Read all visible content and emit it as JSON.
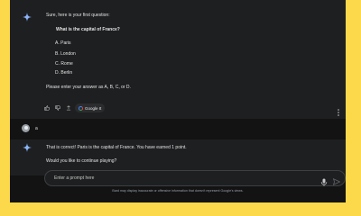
{
  "response_1": {
    "intro": "Sure, here is your first question:",
    "question": "What is the capital of France?",
    "options": [
      "A. Paris",
      "B. London",
      "C. Rome",
      "D. Berlin"
    ],
    "instruction": "Please enter your answer as A, B, C, or D."
  },
  "actions": {
    "icons": [
      "thumb-up-icon",
      "thumb-down-icon",
      "share-icon",
      "google-icon",
      "more-vert-icon"
    ],
    "google_label": "Google It"
  },
  "user_message": {
    "text": "a"
  },
  "response_2": {
    "line1": "That is correct! Paris is the capital of France. You have earned 1 point.",
    "line2": "Would you like to continue playing?"
  },
  "input": {
    "placeholder": "Enter a prompt here"
  },
  "footer": {
    "disclaimer": "Bard may display inaccurate or offensive information that doesn't represent Google's views."
  },
  "colors": {
    "page_bg": "#fcd94a",
    "screen_bg": "#131314",
    "panel_bg": "#1e1f20",
    "accent": "#8ab4f8"
  }
}
